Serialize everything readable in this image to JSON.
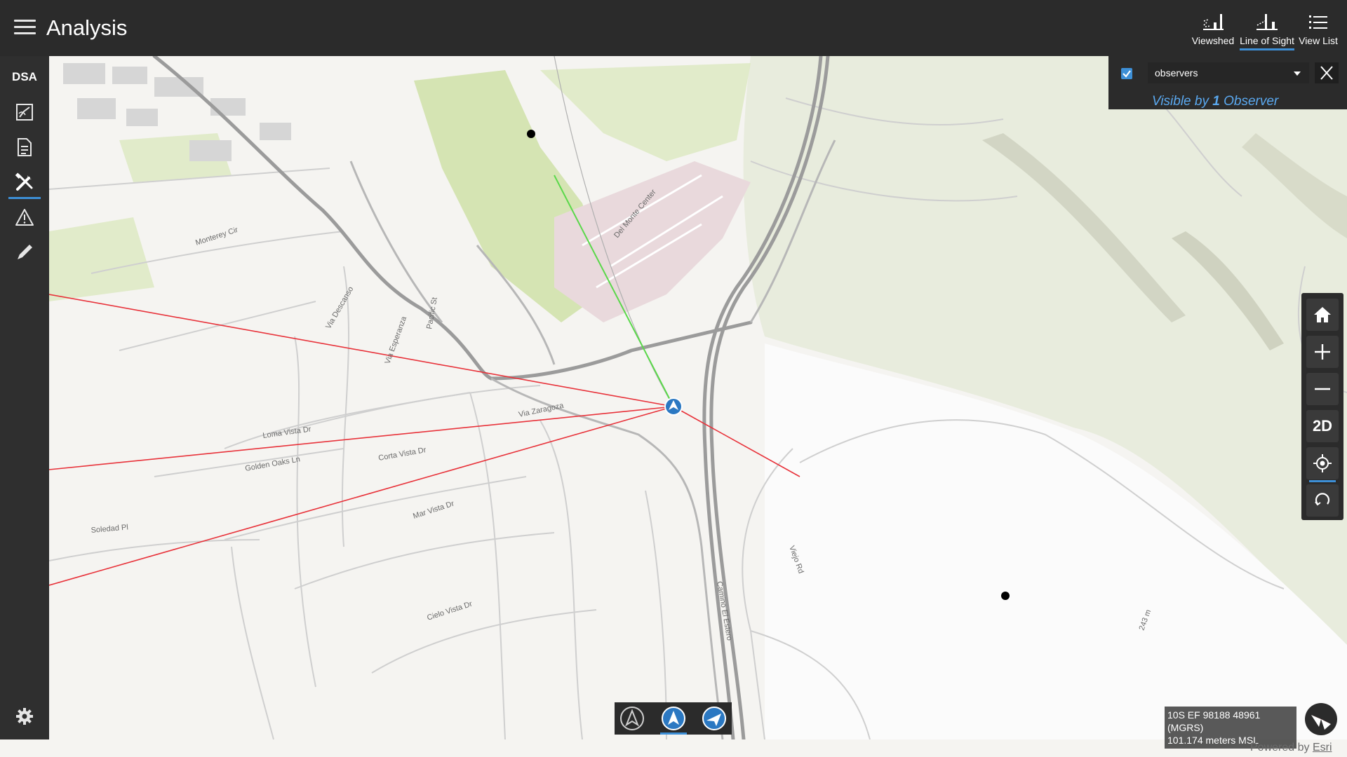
{
  "app": {
    "title": "Analysis"
  },
  "toolbar": {
    "tools": [
      {
        "label": "Viewshed",
        "icon": "viewshed-icon"
      },
      {
        "label": "Line of Sight",
        "icon": "line-of-sight-icon",
        "active": true
      },
      {
        "label": "View List",
        "icon": "list-icon"
      }
    ]
  },
  "sidebar": {
    "header": "DSA",
    "items": [
      {
        "icon": "map-edit-icon"
      },
      {
        "icon": "document-icon"
      },
      {
        "icon": "tools-icon",
        "active": true
      },
      {
        "icon": "warning-icon"
      },
      {
        "icon": "pencil-icon"
      }
    ],
    "footer_icon": "gear-icon"
  },
  "observer_panel": {
    "checked": true,
    "layer": "observers",
    "visible_prefix": "Visible by ",
    "visible_count": "1",
    "visible_suffix": " Observer"
  },
  "map": {
    "labels": {
      "del_monte_center": "Del Monte Center",
      "via_zaragoza": "Via Zaragoza",
      "loma_vista_dr": "Loma Vista Dr",
      "corta_vista_dr": "Corta Vista Dr",
      "golden_oaks_ln": "Golden Oaks Ln",
      "mar_vista_dr": "Mar Vista Dr",
      "soledad_pl": "Soledad Pl",
      "cielo_vista_dr": "Cielo Vista Dr",
      "via_descanso": "Via Descanso",
      "via_esperanza": "Via Esperanza",
      "monterey_cir": "Monterey Cir",
      "viejo_rd": "Viejo Rd",
      "camino_el_estero": "Camino El Estero",
      "pacific_st": "Pacific St",
      "elevation": "243 m"
    }
  },
  "controls": {
    "buttons": [
      {
        "name": "home",
        "icon": "home-icon"
      },
      {
        "name": "zoom-in",
        "icon": "plus-icon"
      },
      {
        "name": "zoom-out",
        "icon": "minus-icon"
      },
      {
        "name": "toggle-2d",
        "text": "2D"
      },
      {
        "name": "locate",
        "icon": "locate-icon",
        "active": true
      },
      {
        "name": "rotate",
        "icon": "rotate-icon"
      }
    ]
  },
  "nav_modes": [
    {
      "icon": "navigation-icon"
    },
    {
      "icon": "navigation-icon",
      "active": true
    },
    {
      "icon": "north-navigation-icon"
    }
  ],
  "status": {
    "mgrs": "10S EF 98188 48961 (MGRS)",
    "elevation": "101.174 meters MSL"
  },
  "credit": {
    "prefix": "Powered by ",
    "link": "Esri"
  },
  "colors": {
    "accent": "#3d8fd6",
    "visible_line": "#5ad84a",
    "blocked_line": "#e8323a",
    "commercial_area": "#e9d9dc",
    "park": "#cfe0a8"
  }
}
